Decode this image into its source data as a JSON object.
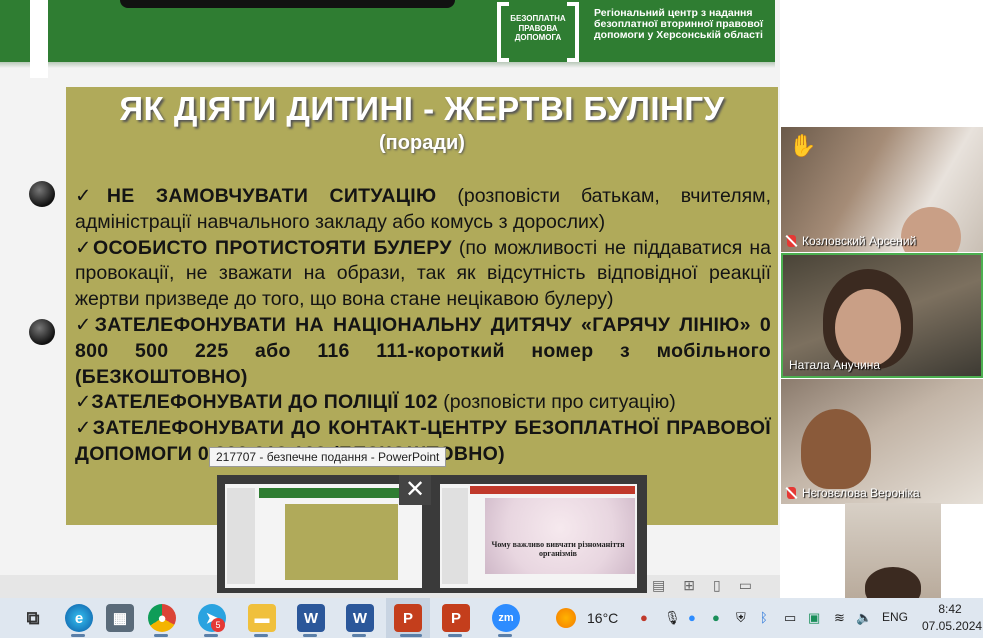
{
  "header": {
    "logo_text": "БЕЗОПЛАТНА ПРАВОВА ДОПОМОГА",
    "org_name": "Регіональний центр з надання безоплатної вторинної правової допомоги у Херсонській області"
  },
  "slide": {
    "title": "ЯК ДІЯТИ ДИТИНІ - ЖЕРТВІ БУЛІНГУ",
    "subtitle": "(поради)",
    "check": "✓",
    "tips": [
      {
        "bold": "НЕ ЗАМОВЧУВАТИ СИТУАЦІЮ",
        "normal": " (розповісти батькам, вчителям, адміністрації навчального закладу або комусь з дорослих)"
      },
      {
        "bold": "ОСОБИСТО ПРОТИСТОЯТИ БУЛЕРУ",
        "normal": " (по можливості не піддаватися на провокації, не зважати на образи, так як відсутність відповідної  реакції жертви призведе до того, що вона стане нецікавою булеру)"
      },
      {
        "bold": "ЗАТЕЛЕФОНУВАТИ НА НАЦІОНАЛЬНУ ДИТЯЧУ «ГАРЯЧУ ЛІНІЮ» 0 800 500 225 або 116 111-короткий номер з мобільного (БЕЗКОШТОВНО)",
        "normal": ""
      },
      {
        "bold": "ЗАТЕЛЕФОНУВАТИ ДО ПОЛІЦІЇ 102",
        "normal": " (розповісти про ситуацію)"
      },
      {
        "bold": "ЗАТЕЛЕФОНУВАТИ ДО КОНТАКТ-ЦЕНТРУ БЕЗОПЛАТНОЇ ПРАВОВОЇ ДОПОМОГИ 0 800 213 103 (БЕЗКОШТОВНО)",
        "normal": ""
      }
    ]
  },
  "participants": [
    {
      "name": "Козловский Арсений",
      "muted": true,
      "hand_raised": true
    },
    {
      "name": "Натала Анучина",
      "muted": false,
      "active_speaker": true
    },
    {
      "name": "Нєговєлова Вероніка",
      "muted": true
    },
    {
      "name": "",
      "muted": false
    }
  ],
  "taskbar_preview": {
    "tooltip": "217707  -  безпечне подання - PowerPoint",
    "thumb2_text": "Чому важливо вивчати різноманіття організмів",
    "close_icon": "✕"
  },
  "taskbar": {
    "weather_temp": "16°C",
    "language": "ENG",
    "time": "8:42",
    "date": "07.05.2024",
    "telegram_badge": "5",
    "icons": [
      "task-view-icon",
      "edge-icon",
      "calculator-icon",
      "chrome-icon",
      "telegram-icon",
      "file-explorer-icon",
      "word-icon",
      "word-icon",
      "powerpoint-icon",
      "powerpoint-icon",
      "zoom-icon"
    ]
  },
  "colors": {
    "header_green": "#2f7d32",
    "slide_olive": "#b0aa5a",
    "active_speaker_border": "#4caf50"
  }
}
